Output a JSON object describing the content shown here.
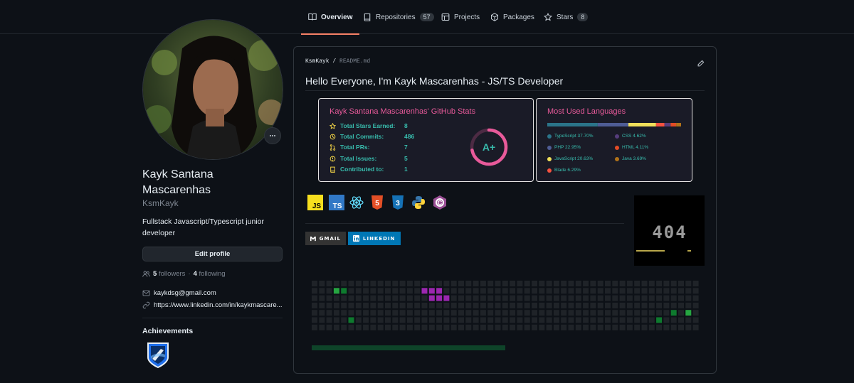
{
  "nav": {
    "tabs": [
      {
        "label": "Overview",
        "icon": "book-icon",
        "active": true
      },
      {
        "label": "Repositories",
        "icon": "repo-icon",
        "count": "57"
      },
      {
        "label": "Projects",
        "icon": "table-icon"
      },
      {
        "label": "Packages",
        "icon": "package-icon"
      },
      {
        "label": "Stars",
        "icon": "star-icon",
        "count": "8"
      }
    ]
  },
  "profile": {
    "name": "Kayk Santana Mascarenhas",
    "name_line1": "Kayk Santana",
    "name_line2": "Mascarenhas",
    "login": "KsmKayk",
    "bio": "Fullstack Javascript/Typescript junior developer",
    "edit_label": "Edit profile",
    "followers_count": "5",
    "followers_label": "followers",
    "following_count": "4",
    "following_label": "following",
    "email": "kaykdsg@gmail.com",
    "website": "https://www.linkedin.com/in/kaykmascare...",
    "achievements_title": "Achievements"
  },
  "readme": {
    "owner": "KsmKayk",
    "file": "README.md",
    "heading": "Hello Everyone, I'm Kayk Mascarenhas - JS/TS Developer",
    "stats_card": {
      "title": "Kayk Santana Mascarenhas' GitHub Stats",
      "rows": [
        {
          "label": "Total Stars Earned:",
          "value": "8",
          "icon": "star-outline-icon"
        },
        {
          "label": "Total Commits:",
          "value": "486",
          "icon": "history-icon"
        },
        {
          "label": "Total PRs:",
          "value": "7",
          "icon": "pull-request-icon"
        },
        {
          "label": "Total Issues:",
          "value": "5",
          "icon": "issue-icon"
        },
        {
          "label": "Contributed to:",
          "value": "1",
          "icon": "repo-outline-icon"
        }
      ],
      "rank": "A+",
      "rank_progress": 0.72,
      "accent": "#e85a9a",
      "text_color": "#38bdae"
    },
    "languages_card": {
      "title": "Most Used Languages",
      "languages": [
        {
          "name": "TypeScript 37.70%",
          "pct": 37.7,
          "color": "#2b7489"
        },
        {
          "name": "CSS 4.62%",
          "pct": 4.62,
          "color": "#563d7c"
        },
        {
          "name": "PHP 22.95%",
          "pct": 22.95,
          "color": "#4F5D95"
        },
        {
          "name": "HTML 4.11%",
          "pct": 4.11,
          "color": "#e34c26"
        },
        {
          "name": "JavaScript 20.63%",
          "pct": 20.63,
          "color": "#f1e05a"
        },
        {
          "name": "Java 3.69%",
          "pct": 3.69,
          "color": "#b07219"
        },
        {
          "name": "Blade 6.29%",
          "pct": 6.29,
          "color": "#f7523f"
        }
      ]
    },
    "tech_icons": [
      "js-icon",
      "ts-icon",
      "react-icon",
      "html5-icon",
      "css3-icon",
      "python-icon",
      "csharp-icon"
    ],
    "tech_labels": {
      "js": "JS",
      "ts": "TS",
      "html": "5",
      "css": "3",
      "cs": "C"
    },
    "badges": {
      "gmail": "GMAIL",
      "linkedin": "LINKEDIN"
    },
    "gif_text": "404"
  }
}
